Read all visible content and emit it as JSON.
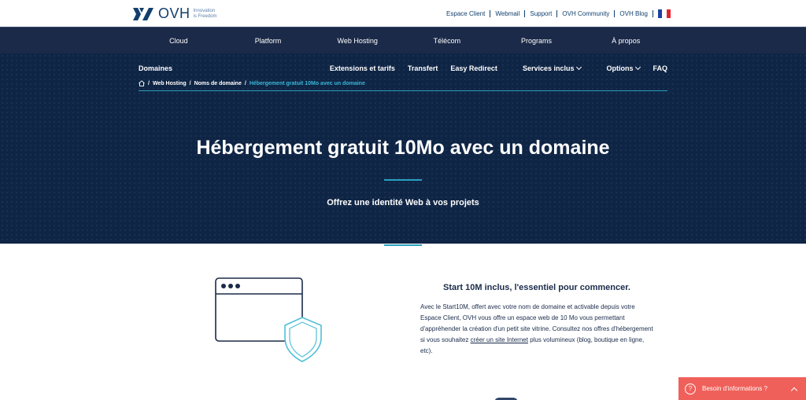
{
  "brand": {
    "name": "OVH",
    "tagline_line1": "Innovation",
    "tagline_line2": "is Freedom"
  },
  "toplinks": [
    "Espace Client",
    "Webmail",
    "Support",
    "OVH Community",
    "OVH Blog"
  ],
  "mainnav": [
    "Cloud",
    "Platform",
    "Web Hosting",
    "Télécom",
    "Programs",
    "À propos"
  ],
  "subnav": {
    "section": "Domaines",
    "items": [
      "Extensions et tarifs",
      "Transfert",
      "Easy Redirect",
      "Services inclus",
      "Options",
      "FAQ"
    ]
  },
  "breadcrumb": [
    "Web Hosting",
    "Noms de domaine",
    "Hébergement gratuit 10Mo avec un domaine"
  ],
  "hero": {
    "title": "Hébergement gratuit 10Mo avec un domaine",
    "subtitle": "Offrez une identité Web à vos projets"
  },
  "content": {
    "title": "Start 10M inclus, l'essentiel pour commencer.",
    "body_before": "Avec le Start10M, offert avec votre nom de domaine et activable depuis votre Espace Client, OVH vous offre un espace web de 10 Mo vous permettant d'appréhender la création d'un petit site vitrine. Consultez nos offres d'hébergement si vous souhaitez ",
    "link": "créer un site Internet",
    "body_after": " plus volumineux (blog, boutique en ligne, etc)."
  },
  "help": {
    "icon": "?",
    "label": "Besoin d'informations ?"
  },
  "colors": {
    "navy": "#1b2a48",
    "hero": "#0f2545",
    "accent": "#2aa0c0",
    "help": "#f0605a"
  }
}
